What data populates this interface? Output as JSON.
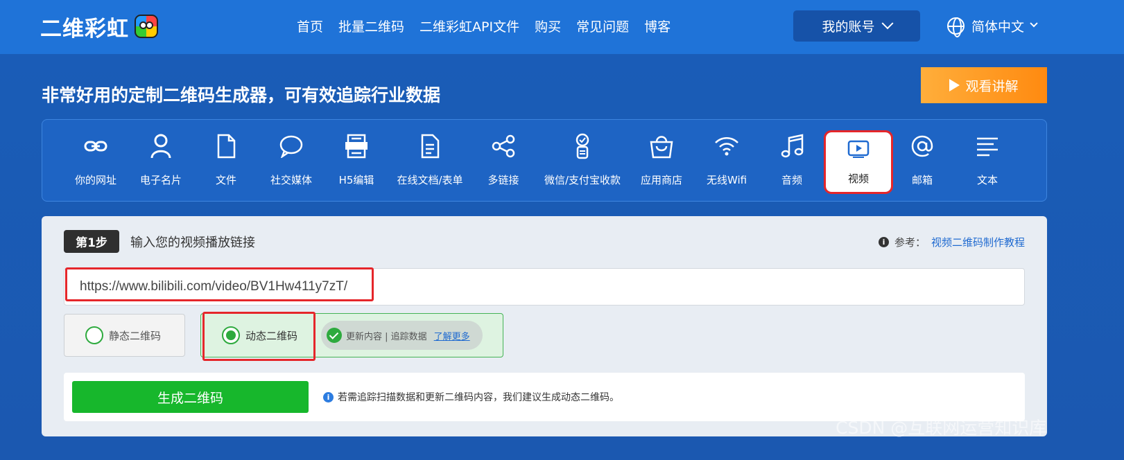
{
  "header": {
    "logo_text": "二维彩虹",
    "nav": [
      "首页",
      "批量二维码",
      "二维彩虹API文件",
      "购买",
      "常见问题",
      "博客"
    ],
    "account_label": "我的账号",
    "language_label": "简体中文"
  },
  "hero": {
    "title": "非常好用的定制二维码生成器，可有效追踪行业数据",
    "watch_label": "观看讲解"
  },
  "types": [
    {
      "label": "你的网址",
      "icon": "link-icon"
    },
    {
      "label": "电子名片",
      "icon": "person-icon"
    },
    {
      "label": "文件",
      "icon": "file-icon"
    },
    {
      "label": "社交媒体",
      "icon": "chat-bubble-icon"
    },
    {
      "label": "H5编辑",
      "icon": "html-icon"
    },
    {
      "label": "在线文档/表单",
      "icon": "document-icon"
    },
    {
      "label": "多链接",
      "icon": "share-icon"
    },
    {
      "label": "微信/支付宝收款",
      "icon": "payment-icon"
    },
    {
      "label": "应用商店",
      "icon": "shopping-bag-icon"
    },
    {
      "label": "无线Wifi",
      "icon": "wifi-icon"
    },
    {
      "label": "音频",
      "icon": "music-note-icon"
    },
    {
      "label": "视频",
      "icon": "video-play-icon"
    },
    {
      "label": "邮箱",
      "icon": "at-sign-icon"
    },
    {
      "label": "文本",
      "icon": "text-lines-icon"
    }
  ],
  "active_type": "视频",
  "step": {
    "badge": "第1步",
    "instruction": "输入您的视频播放链接",
    "ref_prefix": "参考：",
    "ref_link": "视频二维码制作教程",
    "url_value": "https://www.bilibili.com/video/BV1Hw411y7zT/"
  },
  "options": {
    "static_label": "静态二维码",
    "dynamic_label": "动态二维码",
    "dynamic_features": "更新内容 | 追踪数据",
    "learn_more": "了解更多"
  },
  "generate": {
    "button_label": "生成二维码",
    "tip": "若需追踪扫描数据和更新二维码内容，我们建议生成动态二维码。"
  },
  "watermark": "CSDN @互联网运营知识库",
  "colors": {
    "brand_blue": "#1f73d8",
    "accent_orange": "#ff8a10",
    "success_green": "#17b72c",
    "highlight_red": "#e5262a"
  }
}
